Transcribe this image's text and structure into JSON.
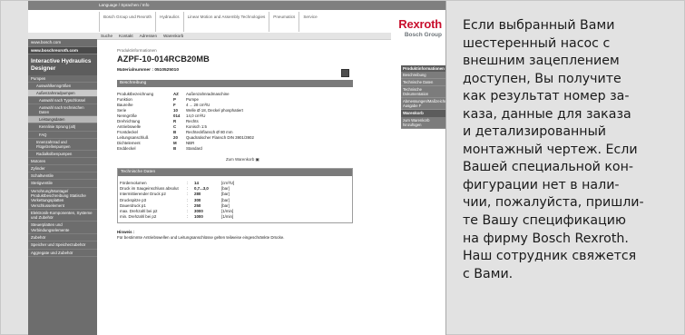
{
  "screenshot": {
    "top_strip": {
      "language_text": "Language / Sprachen / Info"
    },
    "nav_tabs": [
      "Bosch Group und Rexroth",
      "Hydraulics",
      "Linear Motion and Assembly Technologies",
      "Pneumatics",
      "Service"
    ],
    "brand": {
      "name": "Rexroth",
      "group": "Bosch Group"
    },
    "toolbar_items": [
      "Suche",
      "Kontakt",
      "Adressen",
      "Warenkorb"
    ],
    "sidebar": {
      "top_links": [
        "www.bosch.com",
        "www.boschrexroth.com"
      ],
      "title": "Interactive Hydraulics Designer",
      "items": [
        {
          "label": "Pumpen",
          "level": 0,
          "selected": false
        },
        {
          "label": "Auswahlkenngrößen",
          "level": 1,
          "selected": false
        },
        {
          "label": "Außenzahnradpumpen",
          "level": 1,
          "selected": true
        },
        {
          "label": "Auswahl nach Typschlüssel",
          "level": 2,
          "selected": false
        },
        {
          "label": "Auswahl nach technischen Daten",
          "level": 2,
          "selected": false
        },
        {
          "label": "Leistungsdaten",
          "level": 2,
          "selected": true
        },
        {
          "label": "Kennlinie Sprung (alt)",
          "level": 2,
          "selected": false
        },
        {
          "label": "FAQ",
          "level": 2,
          "selected": false
        },
        {
          "label": "Innenzahnrad und Flügelzellenpumpen",
          "level": 1,
          "selected": false
        },
        {
          "label": "Radialkolbenpumpen",
          "level": 1,
          "selected": false
        },
        {
          "label": "Motoren",
          "level": 0,
          "selected": false
        },
        {
          "label": "Zylinder",
          "level": 0,
          "selected": false
        },
        {
          "label": "Schaltventile",
          "level": 0,
          "selected": false
        },
        {
          "label": "Stetigventile",
          "level": 0,
          "selected": false
        },
        {
          "label": "Verrohrung/Montage/ Produktbeschreibung Statische Verkettungsplatten Verschlusselement",
          "level": 0,
          "selected": false
        },
        {
          "label": "Elektronik-Komponenten, Systeme und Zubehör",
          "level": 0,
          "selected": false
        },
        {
          "label": "Steuerplatten und Verbindungselemente",
          "level": 0,
          "selected": false
        },
        {
          "label": "Zubehör",
          "level": 0,
          "selected": false
        },
        {
          "label": "Speicher und Speicherzubehör",
          "level": 0,
          "selected": false
        },
        {
          "label": "Aggregate und Zubehör",
          "level": 0,
          "selected": false
        }
      ]
    },
    "product": {
      "label": "Produktinformationen",
      "code": "AZPF-10-014RCB20MB",
      "material_number": "Materialnummer : 0510525010"
    },
    "description": {
      "heading": "Beschreibung",
      "rows": [
        [
          "Produktbezeichnung",
          "AZ",
          "Außenzahnradmaschine"
        ],
        [
          "Funktion",
          "P",
          "Pumpe"
        ],
        [
          "Baureihe",
          "F",
          "4 ... 28 cm³/U"
        ],
        [
          "Serie",
          "10",
          "Welle Ø 18, Deckel phosphatiert"
        ],
        [
          "Nenngröße",
          "014",
          "14,0 cm³/U"
        ],
        [
          "Drehrichtung",
          "R",
          "Rechts"
        ],
        [
          "Antriebswelle",
          "C",
          "Konisch 1:5"
        ],
        [
          "Frontdeckel",
          "B",
          "Rechteckflansch Ø 80 mm"
        ],
        [
          "Leitungsanschluß",
          "20",
          "Quadratischer Flansch DIN 3901/3902"
        ],
        [
          "Dichtelement",
          "M",
          "NBR"
        ],
        [
          "Enddeckel",
          "B",
          "Standard"
        ]
      ],
      "cart_link": "Zum Warenkorb"
    },
    "technical": {
      "heading": "Technische Daten",
      "rows": [
        [
          "Fördervolumen",
          "14",
          "[cm³/U]"
        ],
        [
          "Druck im Saugeinschluss absolut",
          "0,7...3,0",
          "[bar]"
        ],
        [
          "Intermittierender Druck p2",
          "280",
          "[bar]"
        ],
        [
          "Druckspitze p3",
          "300",
          "[bar]"
        ],
        [
          "Dauerdruck p1",
          "250",
          "[bar]"
        ],
        [
          "max. Drehzahl bei p2",
          "3000",
          "[1/min]"
        ],
        [
          "min. Drehzahl bei p2",
          "1000",
          "[1/min]"
        ]
      ]
    },
    "hint": {
      "title": "Hinweis :",
      "text": "Für bestimmte Antriebswellen und Leitungsanschlüsse gelten teilweise eingeschränkte Drücke."
    },
    "right_column": {
      "heading": "Produktinformationen",
      "items": [
        "Beschreibung",
        "Technische Daten",
        "Technische Dokumentation",
        "Abmessungen/Maßzeichnung Ausgabe F"
      ],
      "heading2": "Warenkorb",
      "items2": [
        "zum Warenkorb hinzufügen"
      ]
    }
  },
  "explanation_lines": [
    "Если выбранный Вами",
    "шестеренный насос с",
    "внешним зацеплением",
    "доступен, Вы получите",
    "как результат номер за-",
    "каза, данные для заказа",
    "и детализированный",
    "монтажный чертеж. Если",
    "Вашей специальной кон-",
    "фигурации нет в нали-",
    "чии, пожалуйста, пришли-",
    "те Вашу спецификацию",
    "на фирму Bosch Rexroth.",
    "Наш сотрудник свяжется",
    "с Вами."
  ]
}
